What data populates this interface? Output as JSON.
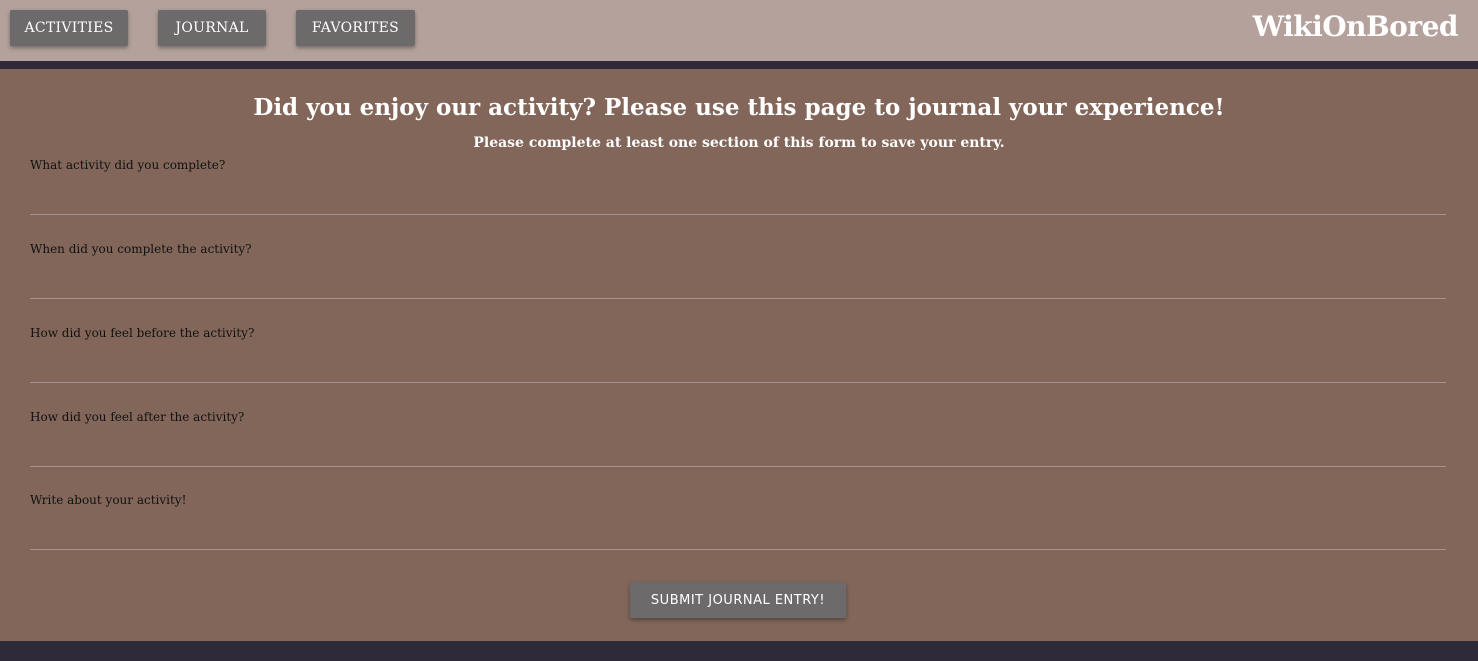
{
  "nav": {
    "activities_label": "ACTIVITIES",
    "journal_label": "JOURNAL",
    "favorites_label": "FAVORITES"
  },
  "brand": {
    "name": "WikiOnBored"
  },
  "page": {
    "heading": "Did you enjoy our activity? Please use this page to journal your experience!",
    "subheading": "Please complete at least one section of this form to save your entry."
  },
  "form": {
    "fields": [
      {
        "label": "What activity did you complete?",
        "value": ""
      },
      {
        "label": "When did you complete the activity?",
        "value": ""
      },
      {
        "label": "How did you feel before the activity?",
        "value": ""
      },
      {
        "label": "How did you feel after the activity?",
        "value": ""
      },
      {
        "label": "Write about your activity!",
        "value": ""
      }
    ],
    "submit_label": "SUBMIT JOURNAL ENTRY!"
  },
  "colors": {
    "topbar": "#b4a19b",
    "main": "#82665a",
    "dark": "#2f2a3a",
    "button": "#6c6a6a"
  }
}
